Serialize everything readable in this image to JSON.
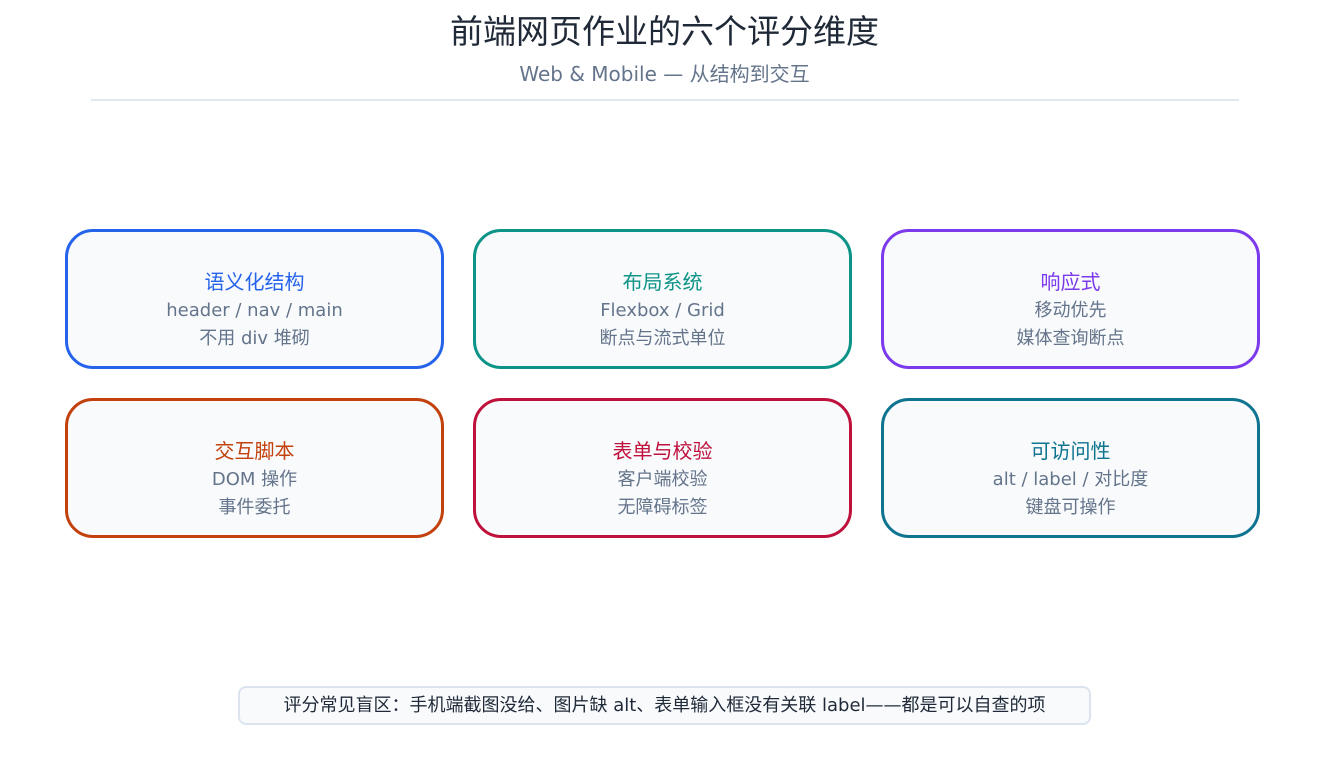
{
  "header": {
    "title": "前端网页作业的六个评分维度",
    "subtitle": "Web & Mobile — 从结构到交互"
  },
  "cards": [
    {
      "title": "语义化结构",
      "line1": "header / nav / main",
      "line2": "不用 div 堆砌",
      "color": "#2563eb"
    },
    {
      "title": "布局系统",
      "line1": "Flexbox / Grid",
      "line2": "断点与流式单位",
      "color": "#0d9488"
    },
    {
      "title": "响应式",
      "line1": "移动优先",
      "line2": "媒体查询断点",
      "color": "#7c3aed"
    },
    {
      "title": "交互脚本",
      "line1": "DOM 操作",
      "line2": "事件委托",
      "color": "#c2410c"
    },
    {
      "title": "表单与校验",
      "line1": "客户端校验",
      "line2": "无障碍标签",
      "color": "#be123c"
    },
    {
      "title": "可访问性",
      "line1": "alt / label / 对比度",
      "line2": "键盘可操作",
      "color": "#0e7490"
    }
  ],
  "footer": {
    "note": "评分常见盲区：手机端截图没给、图片缺 alt、表单输入框没有关联 label——都是可以自查的项"
  }
}
